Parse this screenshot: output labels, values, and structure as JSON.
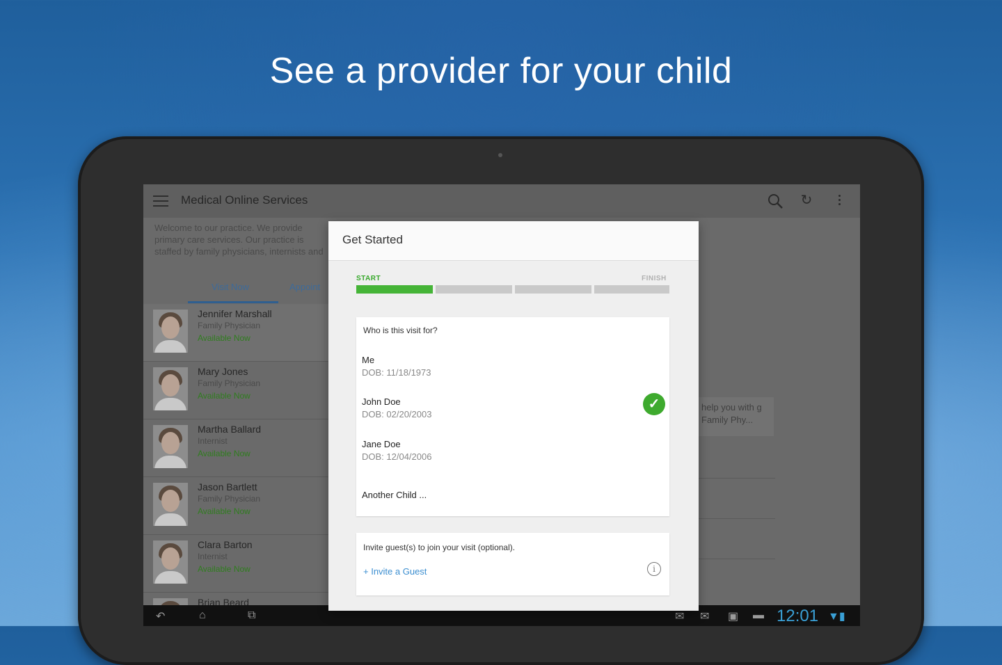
{
  "headline": "See a provider for your child",
  "app": {
    "title": "Medical Online Services",
    "welcome": "Welcome to our practice. We provide primary care services. Our practice is staffed by family physicians, internists and other physicians. How pri...",
    "tabs": [
      "Visit Now",
      "Appoint"
    ],
    "providers": [
      {
        "name": "Jennifer Marshall",
        "role": "Family Physician",
        "status": "Available Now"
      },
      {
        "name": "Mary Jones",
        "role": "Family Physician",
        "status": "Available Now"
      },
      {
        "name": "Martha Ballard",
        "role": "Internist",
        "status": "Available Now"
      },
      {
        "name": "Jason Bartlett",
        "role": "Family Physician",
        "status": "Available Now"
      },
      {
        "name": "Clara Barton",
        "role": "Internist",
        "status": "Available Now"
      },
      {
        "name": "Brian Beard",
        "role": "",
        "status": ""
      }
    ],
    "right_panel_text": "help you with g Family Phy..."
  },
  "dialog": {
    "title": "Get Started",
    "progress": {
      "start_label": "START",
      "finish_label": "FINISH",
      "steps_total": 4,
      "steps_completed": 1
    },
    "question": "Who is this visit for?",
    "people": [
      {
        "name": "Me",
        "dob": "DOB: 11/18/1973",
        "selected": false
      },
      {
        "name": "John Doe",
        "dob": "DOB: 02/20/2003",
        "selected": true
      },
      {
        "name": "Jane Doe",
        "dob": "DOB: 12/04/2006",
        "selected": false
      }
    ],
    "another_child": "Another Child ...",
    "guest_prompt": "Invite guest(s) to join your visit (optional).",
    "invite_link": "+ Invite a Guest"
  },
  "status_bar": {
    "time": "12:01"
  },
  "icons": {
    "menu": "menu-icon",
    "search": "search-icon",
    "refresh": "refresh-icon",
    "overflow": "overflow-icon",
    "check": "check-icon",
    "info": "info-icon",
    "back": "back-icon",
    "home": "home-icon",
    "recents": "recents-icon"
  },
  "colors": {
    "accent_green": "#45b437",
    "link_blue": "#3b8ed0",
    "clock_blue": "#3aa0d6"
  }
}
